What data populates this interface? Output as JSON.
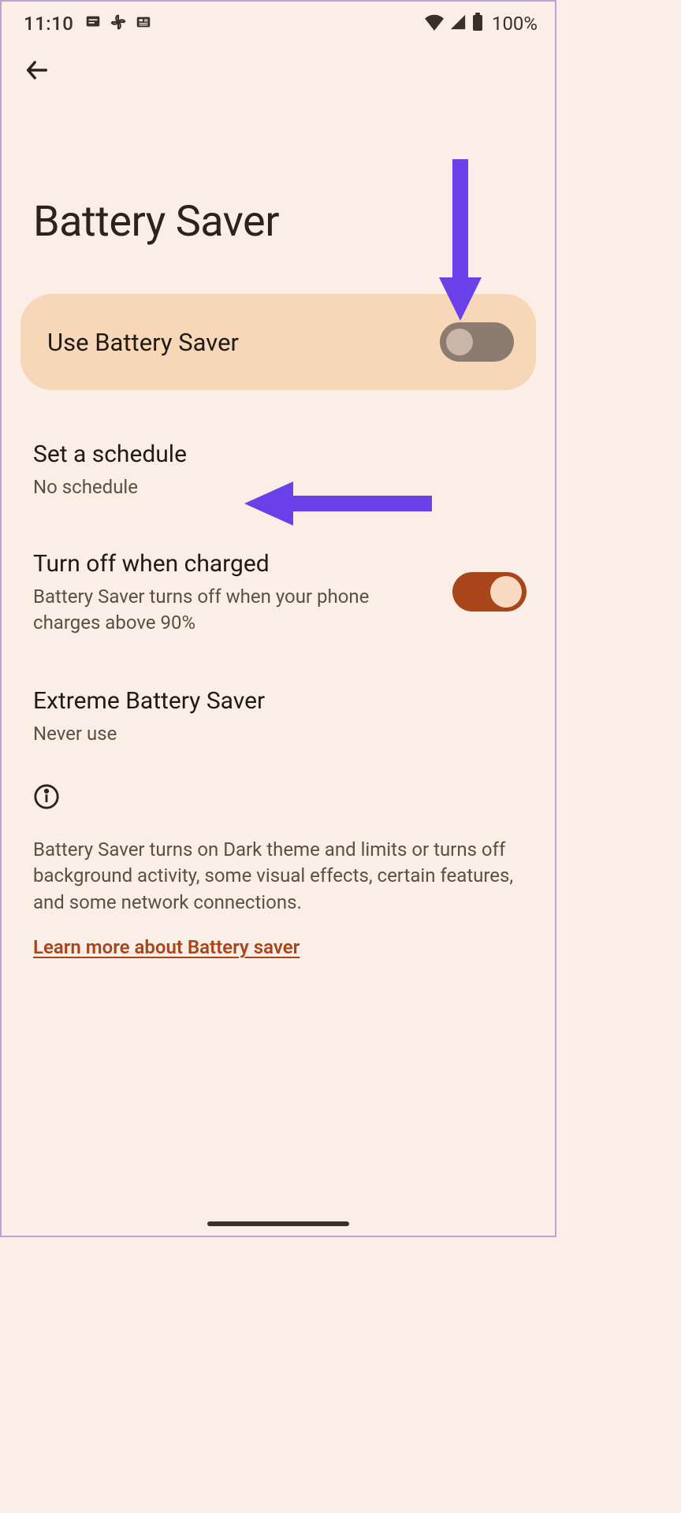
{
  "status": {
    "time": "11:10",
    "battery": "100%"
  },
  "page": {
    "title": "Battery Saver"
  },
  "main_toggle": {
    "label": "Use Battery Saver",
    "enabled": false
  },
  "settings": {
    "schedule": {
      "title": "Set a schedule",
      "subtitle": "No schedule"
    },
    "turn_off": {
      "title": "Turn off when charged",
      "subtitle": "Battery Saver turns off when your phone charges above 90%",
      "enabled": true
    },
    "extreme": {
      "title": "Extreme Battery Saver",
      "subtitle": "Never use"
    }
  },
  "info": {
    "text": "Battery Saver turns on Dark theme and limits or turns off background activity, some visual effects, certain features, and some network connections.",
    "learn_more": "Learn more about Battery saver"
  }
}
